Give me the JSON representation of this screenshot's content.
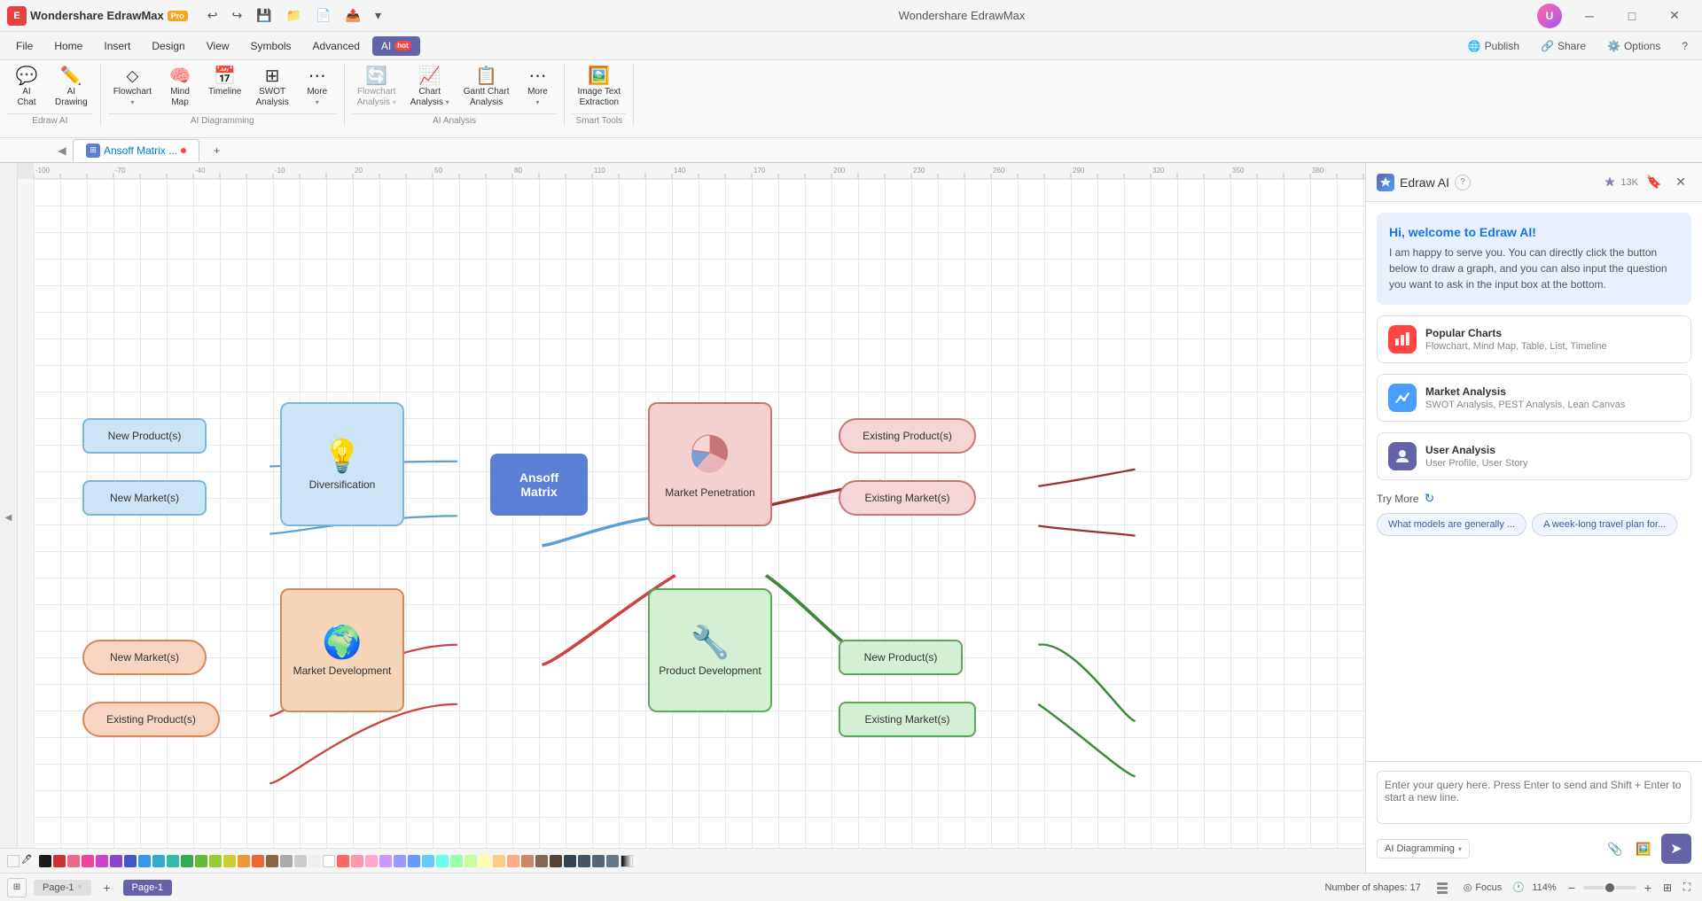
{
  "app": {
    "title": "Wondershare EdrawMax",
    "pro_badge": "Pro"
  },
  "titlebar": {
    "undo_label": "↩",
    "redo_label": "↪",
    "save_label": "💾",
    "open_label": "📁",
    "template_label": "📄",
    "export_label": "📤",
    "more_label": "▾",
    "win_min": "─",
    "win_max": "□",
    "win_close": "✕",
    "avatar_initials": "U"
  },
  "menubar": {
    "items": [
      "File",
      "Home",
      "Insert",
      "Design",
      "View",
      "Symbols",
      "Advanced"
    ],
    "ai_label": "AI",
    "hot_badge": "hot",
    "publish_label": "Publish",
    "share_label": "Share",
    "options_label": "Options",
    "help_label": "?"
  },
  "ribbon": {
    "edraw_ai_group": "Edraw AI",
    "ai_diagramming_group": "AI Diagramming",
    "ai_analysis_group": "AI Analysis",
    "smart_tools_group": "Smart Tools",
    "buttons": [
      {
        "id": "ai-chat",
        "icon": "💬",
        "label": "AI\nChat"
      },
      {
        "id": "ai-drawing",
        "icon": "✏️",
        "label": "AI\nDrawing"
      },
      {
        "id": "flowchart",
        "icon": "🔀",
        "label": "Flowchart",
        "has_arrow": true
      },
      {
        "id": "mind-map",
        "icon": "🧠",
        "label": "Mind\nMap"
      },
      {
        "id": "timeline",
        "icon": "📅",
        "label": "Timeline"
      },
      {
        "id": "swot",
        "icon": "📊",
        "label": "SWOT\nAnalysis"
      },
      {
        "id": "more1",
        "icon": "⋯",
        "label": "More",
        "has_arrow": true
      },
      {
        "id": "flowchart-analysis",
        "icon": "🔄",
        "label": "Flowchart\nAnalysis",
        "has_arrow": true,
        "disabled": true
      },
      {
        "id": "chart-analysis",
        "icon": "📈",
        "label": "Chart\nAnalysis",
        "has_arrow": true
      },
      {
        "id": "gantt-analysis",
        "icon": "📋",
        "label": "Gantt Chart\nAnalysis"
      },
      {
        "id": "more2",
        "icon": "⋯",
        "label": "More",
        "has_arrow": true
      },
      {
        "id": "image-text",
        "icon": "🖼️",
        "label": "Image Text\nExtraction"
      }
    ]
  },
  "tabs": {
    "items": [
      {
        "id": "tab1",
        "label": "Ansoff Matrix ...",
        "active": true,
        "has_dot": true
      },
      {
        "id": "add",
        "label": "+"
      }
    ]
  },
  "canvas": {
    "shapes_count": "Number of shapes: 17",
    "nodes": {
      "center": {
        "label": "Ansoff\nMatrix"
      },
      "diversification": {
        "label": "Diversification"
      },
      "market_penetration": {
        "label": "Market\nPenetration"
      },
      "market_development": {
        "label": "Market\nDevelopment"
      },
      "product_development": {
        "label": "Product\nDevelopment"
      },
      "new_products_1": {
        "label": "New Product(s)"
      },
      "new_markets_1": {
        "label": "New Market(s)"
      },
      "existing_products_1": {
        "label": "Existing Product(s)"
      },
      "existing_markets_1": {
        "label": "Existing Market(s)"
      },
      "new_markets_2": {
        "label": "New Market(s)"
      },
      "existing_products_2": {
        "label": "Existing Product(s)"
      },
      "new_products_2": {
        "label": "New Product(s)"
      },
      "existing_markets_2": {
        "label": "Existing Market(s)"
      }
    }
  },
  "ai_panel": {
    "title": "Edraw AI",
    "help_icon": "?",
    "followers_count": "13K",
    "welcome_title": "Hi, welcome to Edraw AI!",
    "welcome_text": "I am happy to serve you. You can directly click the button below to draw a graph, and you can also input the question you want to ask in the input box at the bottom.",
    "suggestions": [
      {
        "id": "popular-charts",
        "icon": "📊",
        "icon_bg": "#ff4444",
        "title": "Popular Charts",
        "subtitle": "Flowchart, Mind Map, Table, List, Timeline"
      },
      {
        "id": "market-analysis",
        "icon": "📉",
        "icon_bg": "#4a9eff",
        "title": "Market Analysis",
        "subtitle": "SWOT Analysis, PEST Analysis, Lean Canvas"
      },
      {
        "id": "user-analysis",
        "icon": "👤",
        "icon_bg": "#6264a7",
        "title": "User Analysis",
        "subtitle": "User Profile, User Story"
      }
    ],
    "try_more_label": "Try More",
    "try_chips": [
      "What models are generally ...",
      "A week-long travel plan for..."
    ],
    "input_placeholder": "Enter your query here. Press Enter to send and Shift + Enter to start a new line.",
    "mode_label": "AI Diagramming",
    "send_icon": "➤"
  },
  "statusbar": {
    "page_tabs": [
      {
        "id": "page1",
        "label": "Page-1",
        "active": true
      },
      {
        "id": "page1-view",
        "label": "Page-1",
        "active": false
      }
    ],
    "add_page": "+",
    "shapes_count": "Number of shapes: 17",
    "focus_label": "Focus",
    "zoom_level": "114%",
    "fit_label": "⊞",
    "fullscreen_label": "⛶"
  },
  "colors": {
    "accent": "#6264a7",
    "link_blue": "#1a73e8",
    "connection_blue": "#5a9fd4",
    "connection_red": "#cc3333",
    "connection_green": "#3a9a3a"
  }
}
